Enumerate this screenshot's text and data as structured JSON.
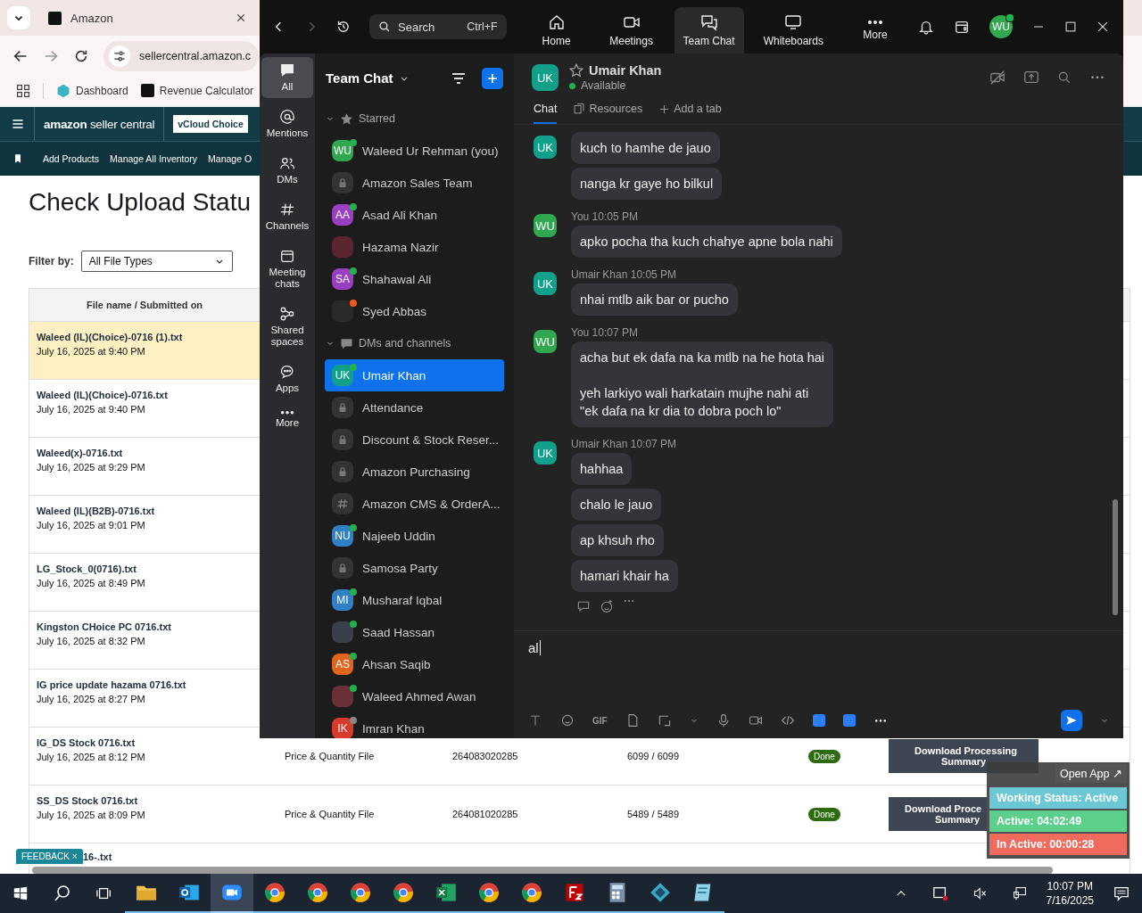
{
  "browser": {
    "tab_title": "Amazon",
    "url": "sellercentral.amazon.c",
    "bookmarks": [
      "Dashboard",
      "Revenue Calculator"
    ]
  },
  "amazon": {
    "logo_brand": "amazon",
    "logo_product": "seller central",
    "account": "vCloud Choice",
    "nav": [
      "Add Products",
      "Manage All Inventory",
      "Manage O"
    ]
  },
  "page": {
    "title": "Check Upload Statu",
    "filter_label": "Filter by:",
    "filter_value": "All File Types",
    "columns": [
      "File name / Submitted on"
    ],
    "rows": [
      {
        "name": "Waleed (IL)(Choice)-0716 (1).txt",
        "date": "July 16, 2025 at 9:40 PM",
        "selected": true
      },
      {
        "name": "Waleed (IL)(Choice)-0716.txt",
        "date": "July 16, 2025 at 9:40 PM",
        "selected": false
      },
      {
        "name": "Waleed(x)-0716.txt",
        "date": "July 16, 2025 at 9:29 PM",
        "selected": false
      },
      {
        "name": "Waleed (IL)(B2B)-0716.txt",
        "date": "July 16, 2025 at 9:01 PM",
        "selected": false
      },
      {
        "name": "LG_Stock_0(0716).txt",
        "date": "July 16, 2025 at 8:49 PM",
        "selected": false
      },
      {
        "name": "Kingston CHoice PC 0716.txt",
        "date": "July 16, 2025 at 8:32 PM",
        "selected": false
      },
      {
        "name": "IG price update hazama 0716.txt",
        "date": "July 16, 2025 at 8:27 PM",
        "selected": false
      },
      {
        "name": "IG_DS Stock 0716.txt",
        "date": "July 16, 2025 at 8:12 PM",
        "selected": false,
        "type": "Price & Quantity File",
        "batch": "264083020285",
        "records": "6099 / 6099",
        "status": "Done",
        "action": [
          "Download Processing",
          "Summary"
        ]
      },
      {
        "name": "SS_DS Stock 0716.txt",
        "date": "July 16, 2025 at 8:09 PM",
        "selected": false,
        "type": "Price & Quantity File",
        "batch": "264081020285",
        "records": "5489 / 5489",
        "status": "Done",
        "action": [
          "Download Proce",
          "Summary"
        ]
      },
      {
        "name": "16-.txt",
        "selected": false
      }
    ],
    "feedback": "FEEDBACK",
    "feedback_close": "×"
  },
  "zoom": {
    "search": {
      "placeholder": "Search",
      "shortcut": "Ctrl+F"
    },
    "nav": [
      {
        "label": "Home",
        "kind": "home",
        "selected": false
      },
      {
        "label": "Meetings",
        "kind": "meetings",
        "selected": false
      },
      {
        "label": "Team Chat",
        "kind": "chat",
        "selected": true
      },
      {
        "label": "Whiteboards",
        "kind": "whiteboards",
        "selected": false
      },
      {
        "label": "More",
        "kind": "more",
        "selected": false
      }
    ],
    "avatar": "WU",
    "rail": [
      {
        "label": "All",
        "kind": "all",
        "selected": true
      },
      {
        "label": "Mentions",
        "kind": "mentions",
        "selected": false
      },
      {
        "label": "DMs",
        "kind": "dms",
        "selected": false
      },
      {
        "label": "Channels",
        "kind": "channels",
        "selected": false
      },
      {
        "label": "Meeting chats",
        "kind": "meetings",
        "selected": false
      },
      {
        "label": "Shared spaces",
        "kind": "shared",
        "selected": false
      },
      {
        "label": "Apps",
        "kind": "apps",
        "selected": false
      },
      {
        "label": "More",
        "kind": "more",
        "selected": false
      }
    ],
    "list_title": "Team Chat",
    "sections": [
      {
        "title": "Starred",
        "kind": "starred",
        "expanded": true,
        "items": [
          {
            "name": "Waleed Ur Rehman (you)",
            "kind": "initials",
            "initials": "WU",
            "color": "#2fa84f",
            "presence": {
              "color": "#22b14c"
            },
            "selected": false
          },
          {
            "name": "Amazon Sales Team",
            "kind": "lock",
            "selected": false
          },
          {
            "name": "Asad Ali Khan",
            "kind": "initials",
            "initials": "AA",
            "color": "#9a3fc2",
            "presence": {
              "color": "#22b14c"
            },
            "selected": false
          },
          {
            "name": "Hazama Nazir",
            "kind": "photo",
            "color": "#5a2430",
            "selected": false
          },
          {
            "name": "Shahawal Ali",
            "kind": "initials",
            "initials": "SA",
            "color": "#9a3fc2",
            "presence": {
              "color": "#22b14c"
            },
            "selected": false
          },
          {
            "name": "Syed Abbas",
            "kind": "photo",
            "color": "#2a2a2a",
            "presence": {
              "color": "#f05a22"
            },
            "selected": false
          }
        ]
      },
      {
        "title": "DMs and channels",
        "kind": "dms",
        "expanded": true,
        "items": [
          {
            "name": "Umair Khan",
            "kind": "initials",
            "initials": "UK",
            "color": "#12a08a",
            "presence": {
              "color": "#22b14c"
            },
            "selected": true
          },
          {
            "name": "Attendance",
            "kind": "lock",
            "selected": false
          },
          {
            "name": "Discount & Stock Reser...",
            "kind": "lock",
            "selected": false
          },
          {
            "name": "Amazon Purchasing",
            "kind": "lock",
            "selected": false
          },
          {
            "name": "Amazon CMS & OrderA...",
            "kind": "hash",
            "selected": false
          },
          {
            "name": "Najeeb Uddin",
            "kind": "initials",
            "initials": "NU",
            "color": "#2f80c4",
            "presence": {
              "color": "#22b14c"
            },
            "selected": false
          },
          {
            "name": "Samosa Party",
            "kind": "lock",
            "selected": false
          },
          {
            "name": "Musharaf Iqbal",
            "kind": "initials",
            "initials": "MI",
            "color": "#2f80c4",
            "presence": {
              "color": "#22b14c"
            },
            "selected": false
          },
          {
            "name": "Saad Hassan",
            "kind": "photo",
            "color": "#3a3f4a",
            "presence": {
              "color": "#22b14c"
            },
            "selected": false
          },
          {
            "name": "Ahsan Saqib",
            "kind": "initials",
            "initials": "AS",
            "color": "#e0631e",
            "presence": {
              "color": "#22b14c"
            },
            "selected": false
          },
          {
            "name": "Waleed Ahmed Awan",
            "kind": "photo",
            "color": "#6a3038",
            "presence": {
              "color": "#22b14c"
            },
            "selected": false
          },
          {
            "name": "Imran Khan",
            "kind": "initials",
            "initials": "IK",
            "color": "#d83a2c",
            "presence": {
              "color": "#8a8a8a"
            },
            "selected": false
          }
        ]
      }
    ],
    "chat": {
      "contact": {
        "initials": "UK",
        "color": "#12a08a",
        "name": "Umair Khan",
        "status": "Available"
      },
      "tabs": [
        {
          "label": "Chat",
          "kind": "chat",
          "selected": true
        },
        {
          "label": "Resources",
          "kind": "resources",
          "selected": false
        },
        {
          "label": "Add a tab",
          "kind": "add",
          "selected": false
        }
      ],
      "groups": [
        {
          "initials": "UK",
          "color": "#12a08a",
          "messages": [
            "kuch to hamhe de jauo",
            "nanga kr gaye ho bilkul"
          ]
        },
        {
          "sender": "You",
          "time": "10:05 PM",
          "initials": "WU",
          "color": "#2fa84f",
          "messages": [
            "apko pocha tha kuch chahye apne bola nahi"
          ]
        },
        {
          "sender": "Umair Khan",
          "time": "10:05 PM",
          "initials": "UK",
          "color": "#12a08a",
          "messages": [
            "nhai mtlb aik bar or pucho"
          ]
        },
        {
          "sender": "You",
          "time": "10:07 PM",
          "initials": "WU",
          "color": "#2fa84f",
          "messages": [
            "acha but ek dafa na ka mtlb na he hota hai\n\nyeh larkiyo wali harkatain mujhe nahi ati\n\"ek dafa na kr dia to dobra poch lo\""
          ]
        },
        {
          "sender": "Umair Khan",
          "time": "10:07 PM",
          "initials": "UK",
          "color": "#12a08a",
          "messages": [
            "hahhaa",
            "chalo le jauo",
            "ap khsuh rho",
            "hamari khair ha"
          ]
        }
      ],
      "composer": {
        "value": "al",
        "gif_label": "GIF"
      }
    }
  },
  "widget": {
    "open_app": "Open App ↗",
    "items": [
      {
        "label": "Working Status: Active",
        "color": "#6cc8d4"
      },
      {
        "label": "Active: 04:02:49",
        "color": "#5ccf8a"
      },
      {
        "label": "In Active: 00:00:28",
        "color": "#ee6b5e"
      }
    ]
  },
  "taskbar": {
    "apps": [
      {
        "kind": "explorer",
        "selected": false
      },
      {
        "kind": "outlook",
        "selected": false
      },
      {
        "kind": "zoom",
        "selected": true
      },
      {
        "kind": "chrome",
        "selected": false
      },
      {
        "kind": "chrome",
        "selected": false
      },
      {
        "kind": "chrome",
        "selected": false
      },
      {
        "kind": "chrome",
        "selected": false
      },
      {
        "kind": "excel",
        "selected": false
      },
      {
        "kind": "chrome",
        "selected": false
      },
      {
        "kind": "chrome",
        "selected": false
      },
      {
        "kind": "filezilla",
        "selected": false
      },
      {
        "kind": "calculator",
        "selected": false
      },
      {
        "kind": "diamond",
        "selected": false
      },
      {
        "kind": "notes",
        "selected": false
      }
    ],
    "time": "10:07 PM",
    "date": "7/16/2025"
  }
}
